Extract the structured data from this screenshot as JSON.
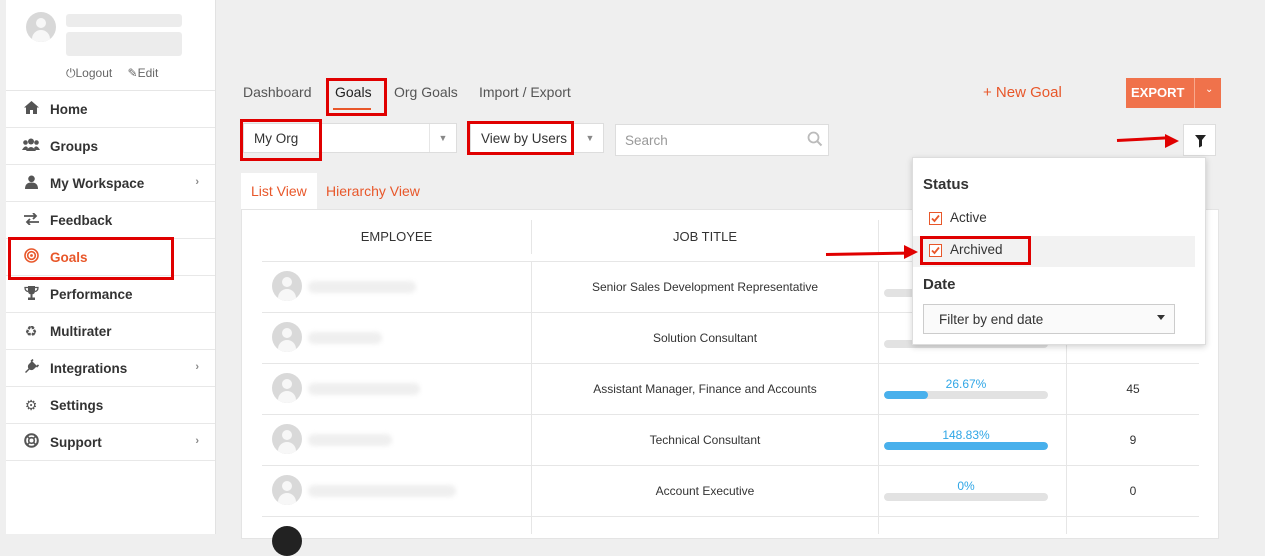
{
  "sidebar": {
    "profile": {
      "logout_label": "Logout",
      "edit_label": "Edit"
    },
    "items": [
      {
        "label": "Home",
        "icon": "home-icon",
        "has_submenu": false
      },
      {
        "label": "Groups",
        "icon": "groups-icon",
        "has_submenu": false
      },
      {
        "label": "My Workspace",
        "icon": "user-icon",
        "has_submenu": true
      },
      {
        "label": "Feedback",
        "icon": "swap-arrows-icon",
        "has_submenu": false
      },
      {
        "label": "Goals",
        "icon": "target-icon",
        "has_submenu": false,
        "active": true
      },
      {
        "label": "Performance",
        "icon": "trophy-icon",
        "has_submenu": false
      },
      {
        "label": "Multirater",
        "icon": "recycle-icon",
        "has_submenu": false
      },
      {
        "label": "Integrations",
        "icon": "plug-icon",
        "has_submenu": true
      },
      {
        "label": "Settings",
        "icon": "gear-icon",
        "has_submenu": false
      },
      {
        "label": "Support",
        "icon": "lifebuoy-icon",
        "has_submenu": true
      }
    ]
  },
  "top_tabs": [
    {
      "label": "Dashboard"
    },
    {
      "label": "Goals",
      "active": true
    },
    {
      "label": "Org Goals"
    },
    {
      "label": "Import / Export"
    }
  ],
  "actions": {
    "new_goal_label": "+ New Goal",
    "export_label": "EXPORT"
  },
  "filters": {
    "org_select": "My Org",
    "view_select": "View by Users",
    "search_placeholder": "Search"
  },
  "view_tabs": [
    {
      "label": "List View",
      "active": true
    },
    {
      "label": "Hierarchy View"
    }
  ],
  "table": {
    "columns": [
      "EMPLOYEE",
      "JOB TITLE"
    ],
    "rows": [
      {
        "job_title": "Senior Sales Development Representative",
        "progress_label": "",
        "progress": null,
        "count": ""
      },
      {
        "job_title": "Solution Consultant",
        "progress_label": "",
        "progress": null,
        "count": ""
      },
      {
        "job_title": "Assistant Manager, Finance and Accounts",
        "progress_label": "26.67%",
        "progress": 26.67,
        "count": "45"
      },
      {
        "job_title": "Technical Consultant",
        "progress_label": "148.83%",
        "progress": 148.83,
        "count": "9"
      },
      {
        "job_title": "Account Executive",
        "progress_label": "0%",
        "progress": 0,
        "count": "0"
      }
    ]
  },
  "filter_popover": {
    "status_title": "Status",
    "status_options": [
      {
        "label": "Active",
        "checked": true
      },
      {
        "label": "Archived",
        "checked": true
      }
    ],
    "date_title": "Date",
    "date_select": "Filter by end date"
  },
  "colors": {
    "accent": "#e8572a",
    "export_button": "#f0724b",
    "progress_fill": "#48b0ec",
    "progress_text": "#2fa6e6",
    "annotation_red": "#e00000"
  }
}
